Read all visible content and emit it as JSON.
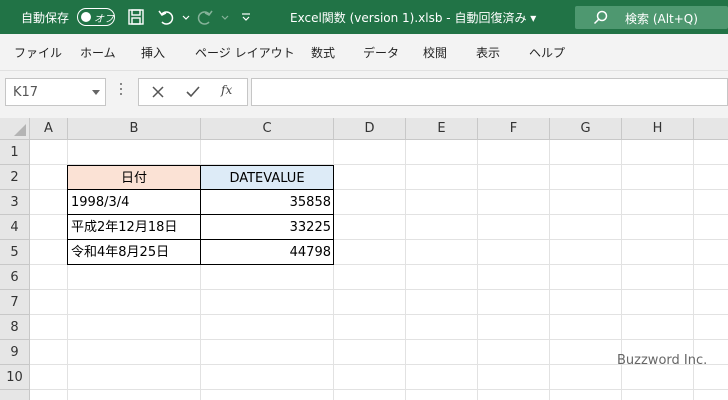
{
  "titlebar": {
    "autosave_label": "自動保存",
    "autosave_state": "オフ",
    "document_title": "Excel関数 (version 1).xlsb  -  自動回復済み  ▾",
    "search_label": "検索 (Alt+Q)",
    "color": "#217346"
  },
  "ribbon": {
    "tabs": [
      "ファイル",
      "ホーム",
      "挿入",
      "ページ レイアウト",
      "数式",
      "データ",
      "校閲",
      "表示",
      "ヘルプ"
    ]
  },
  "formula_bar": {
    "name_box": "K17",
    "fx_label": "fx",
    "formula": ""
  },
  "sheet": {
    "columns": [
      "A",
      "B",
      "C",
      "D",
      "E",
      "F",
      "G",
      "H"
    ],
    "rows": [
      "1",
      "2",
      "3",
      "4",
      "5",
      "6",
      "7",
      "8",
      "9",
      "10"
    ],
    "table": {
      "header_date": "日付",
      "header_datevalue": "DATEVALUE",
      "header_date_color": "#fbe2d5",
      "header_datevalue_color": "#ddebf7",
      "rows": [
        {
          "date": "1998/3/4",
          "value": "35858"
        },
        {
          "date": "平成2年12月18日",
          "value": "33225"
        },
        {
          "date": "令和4年8月25日",
          "value": "44798"
        }
      ]
    }
  },
  "watermark": "Buzzword Inc."
}
